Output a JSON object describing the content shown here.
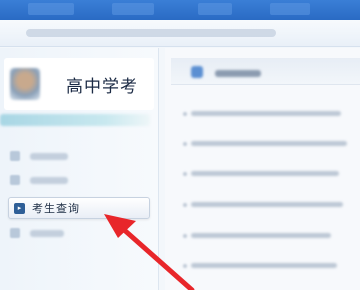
{
  "sidebar": {
    "app_title": "高中学考",
    "active_item": {
      "label": "考生查询",
      "icon": "arrow-right-icon"
    }
  },
  "annotation": {
    "arrow_color": "#e8262a"
  }
}
